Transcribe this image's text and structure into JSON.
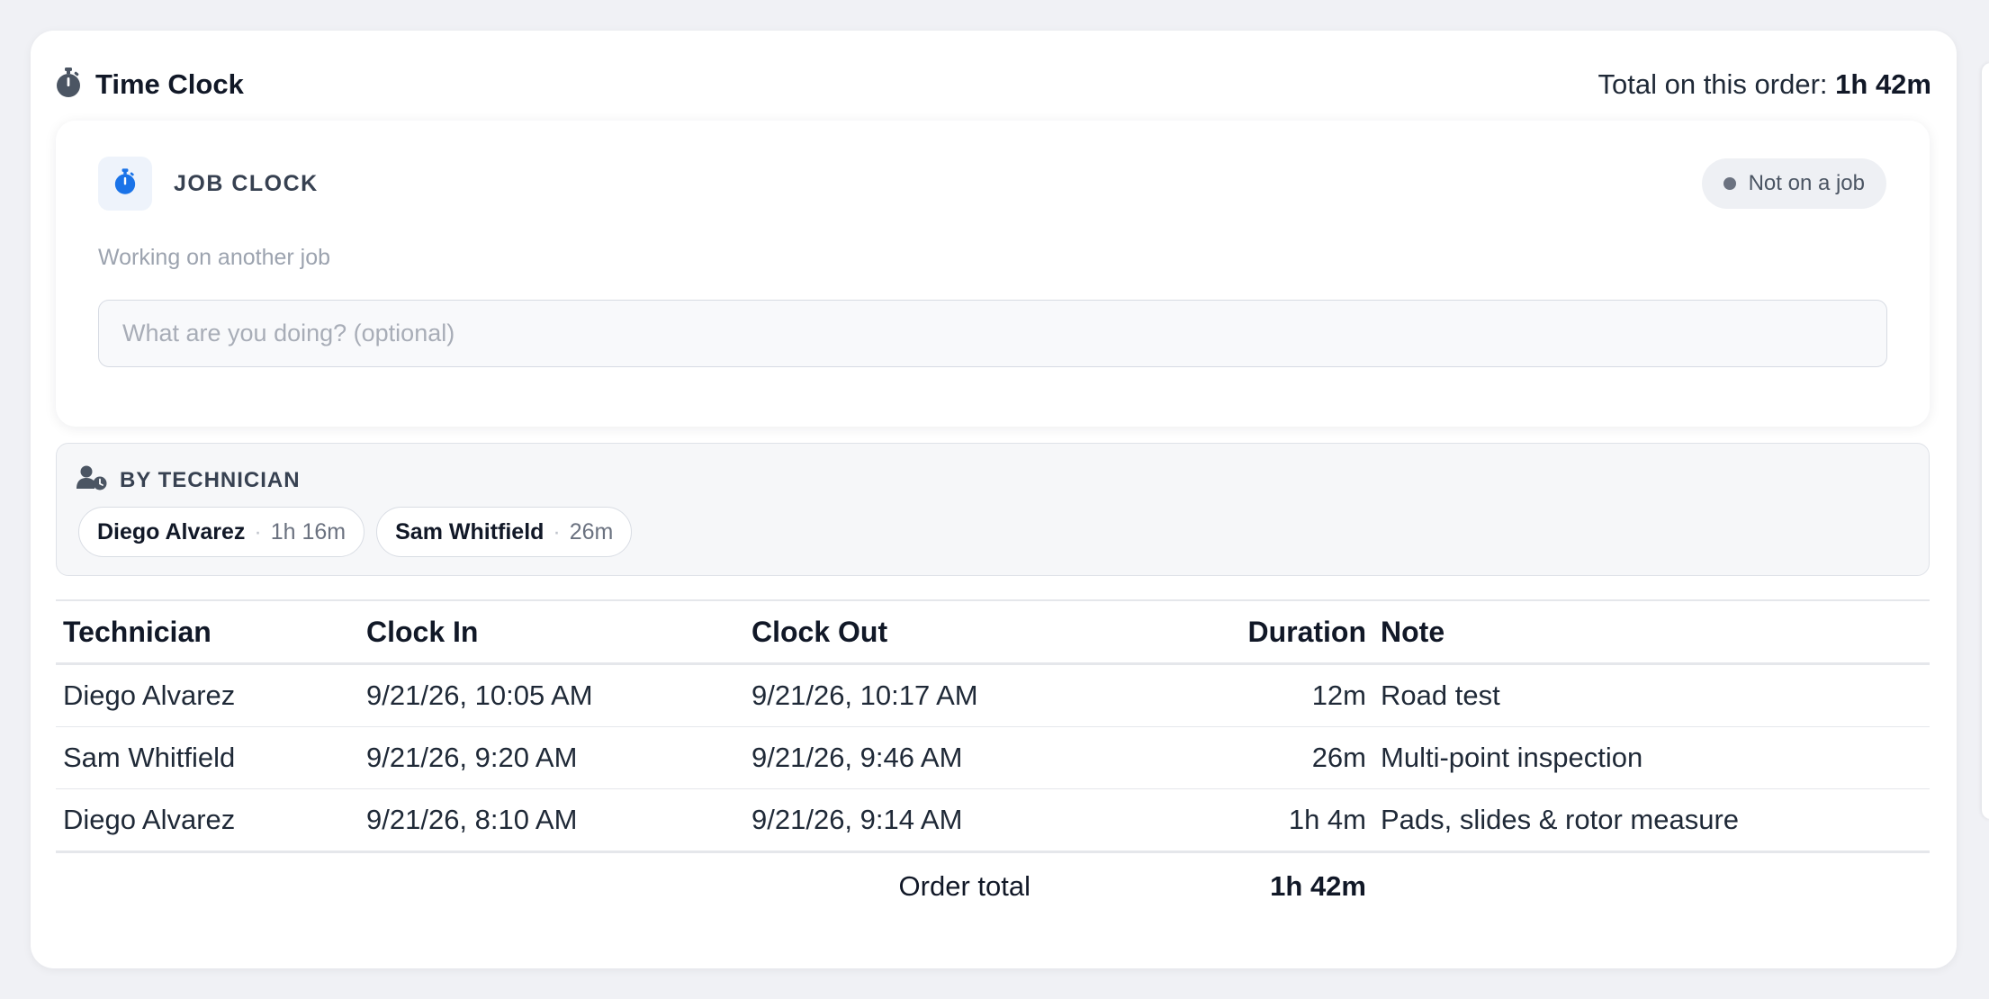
{
  "header": {
    "title": "Time Clock",
    "total_label": "Total on this order:",
    "total_value": "1h 42m"
  },
  "job_clock": {
    "title": "JOB CLOCK",
    "status": "Not on a job",
    "subtitle": "Working on another job",
    "note_placeholder": "What are you doing? (optional)",
    "note_value": ""
  },
  "by_technician": {
    "title": "BY TECHNICIAN",
    "chips": [
      {
        "name": "Diego Alvarez",
        "separator": "·",
        "time": "1h 16m"
      },
      {
        "name": "Sam Whitfield",
        "separator": "·",
        "time": "26m"
      }
    ]
  },
  "table": {
    "columns": [
      "Technician",
      "Clock In",
      "Clock Out",
      "Duration",
      "Note"
    ],
    "rows": [
      {
        "technician": "Diego Alvarez",
        "clock_in": "9/21/26, 10:05 AM",
        "clock_out": "9/21/26, 10:17 AM",
        "duration": "12m",
        "note": "Road test"
      },
      {
        "technician": "Sam Whitfield",
        "clock_in": "9/21/26, 9:20 AM",
        "clock_out": "9/21/26, 9:46 AM",
        "duration": "26m",
        "note": "Multi-point inspection"
      },
      {
        "technician": "Diego Alvarez",
        "clock_in": "9/21/26, 8:10 AM",
        "clock_out": "9/21/26, 9:14 AM",
        "duration": "1h 4m",
        "note": "Pads, slides & rotor measure"
      }
    ],
    "footer": {
      "label": "Order total",
      "value": "1h 42m"
    }
  },
  "colors": {
    "accent": "#1a73e8",
    "icon_gray": "#4b5563",
    "status_dot": "#6b7280"
  },
  "icons": {
    "header": "stopwatch-icon",
    "job_clock": "stopwatch-icon",
    "by_technician": "user-clock-icon"
  }
}
